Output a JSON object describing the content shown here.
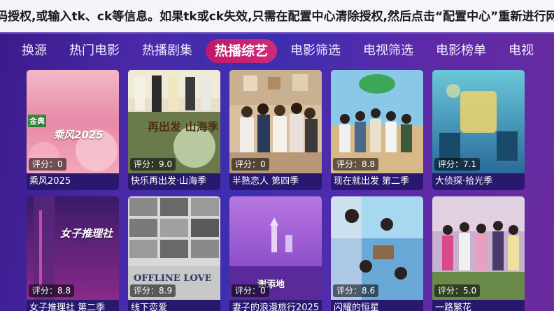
{
  "notice": {
    "text": "码授权,或输入tk、ck等信息。如果tk或ck失效,只需在配置中心清除授权,然后点击“配置中心”重新进行网盘扫码"
  },
  "tabs": [
    {
      "label": "换源",
      "active": false
    },
    {
      "label": "热门电影",
      "active": false
    },
    {
      "label": "热播剧集",
      "active": false
    },
    {
      "label": "热播综艺",
      "active": true
    },
    {
      "label": "电影筛选",
      "active": false
    },
    {
      "label": "电视筛选",
      "active": false
    },
    {
      "label": "电影榜单",
      "active": false
    },
    {
      "label": "电视",
      "active": false
    }
  ],
  "cards": [
    {
      "title": "乘风2025",
      "score": "评分：0",
      "poster_text": "乘风2025",
      "badge": "金典"
    },
    {
      "title": "快乐再出发·山海季",
      "score": "评分：9.0",
      "poster_text": "再出发 山海季"
    },
    {
      "title": "半熟恋人 第四季",
      "score": "评分：0",
      "poster_text": ""
    },
    {
      "title": "现在就出发 第二季",
      "score": "评分：8.8",
      "poster_text": ""
    },
    {
      "title": "大侦探·拾光季",
      "score": "评分：7.1",
      "poster_text": ""
    },
    {
      "title": "女子推理社 第二季",
      "score": "评分：8.8",
      "poster_text": "女子推理社"
    },
    {
      "title": "线下恋爱",
      "score": "评分：8.9",
      "poster_text": "OFFLINE LOVE"
    },
    {
      "title": "妻子的浪漫旅行2025",
      "score": "评分：0",
      "poster_text": "谢添地"
    },
    {
      "title": "闪耀的恒星",
      "score": "评分：8.6",
      "poster_text": ""
    },
    {
      "title": "一路繁花",
      "score": "评分：5.0",
      "poster_text": ""
    }
  ],
  "colors": {
    "active_tab": "#c2186b",
    "background": "#3b2fb0"
  }
}
